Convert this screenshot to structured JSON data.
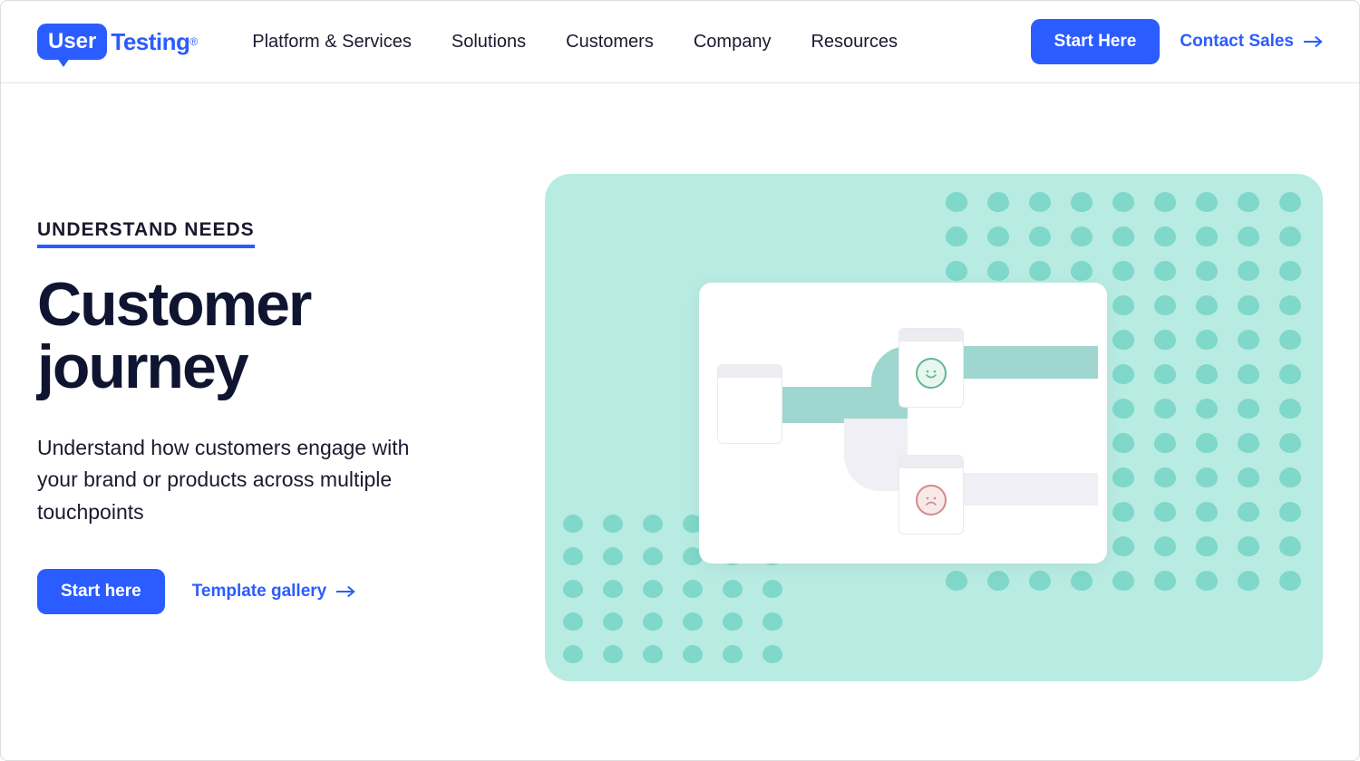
{
  "brand": {
    "mark": "User",
    "word": "Testing"
  },
  "nav": {
    "items": [
      {
        "label": "Platform & Services"
      },
      {
        "label": "Solutions"
      },
      {
        "label": "Customers"
      },
      {
        "label": "Company"
      },
      {
        "label": "Resources"
      }
    ]
  },
  "header_cta": {
    "primary": "Start Here",
    "contact": "Contact Sales"
  },
  "hero": {
    "eyebrow": "UNDERSTAND NEEDS",
    "headline": "Customer journey",
    "subhead": "Understand how customers engage with your brand or products across multiple touchpoints",
    "primary_cta": "Start here",
    "secondary_link": "Template gallery"
  },
  "icon_names": {
    "arrow": "arrow-right-icon",
    "happy": "happy-face-icon",
    "sad": "sad-face-icon"
  }
}
